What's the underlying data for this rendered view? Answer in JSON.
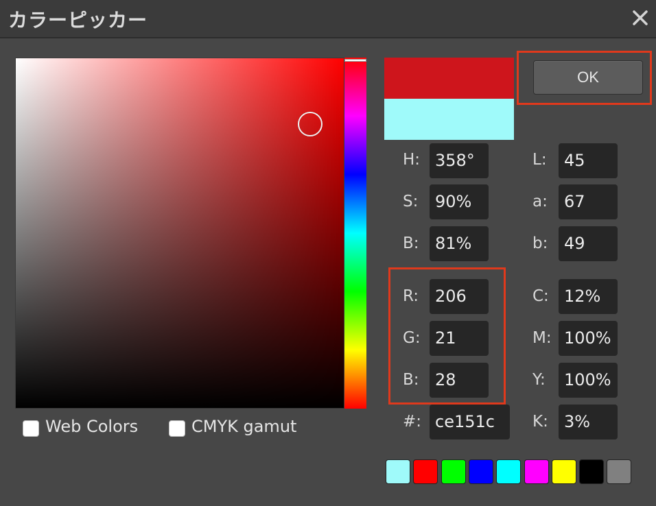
{
  "window": {
    "title": "カラーピッカー"
  },
  "ok_button": {
    "label": "OK"
  },
  "hsb": [
    {
      "label": "H:",
      "value": "358°"
    },
    {
      "label": "S:",
      "value": "90%"
    },
    {
      "label": "B:",
      "value": "81%"
    }
  ],
  "lab": [
    {
      "label": "L:",
      "value": "45"
    },
    {
      "label": "a:",
      "value": "67"
    },
    {
      "label": "b:",
      "value": "49"
    }
  ],
  "rgb": [
    {
      "label": "R:",
      "value": "206"
    },
    {
      "label": "G:",
      "value": "21"
    },
    {
      "label": "B:",
      "value": "28"
    }
  ],
  "cmyk": [
    {
      "label": "C:",
      "value": "12%"
    },
    {
      "label": "M:",
      "value": "100%"
    },
    {
      "label": "Y:",
      "value": "100%"
    },
    {
      "label": "K:",
      "value": "3%"
    }
  ],
  "hex": {
    "label": "#:",
    "value": "ce151c"
  },
  "options": {
    "web_colors": "Web Colors",
    "cmyk_gamut": "CMYK gamut"
  },
  "colors": {
    "new": "#ce151c",
    "original": "#9ffafa",
    "highlight": "#e0391c"
  },
  "swatches": [
    "#9ffafa",
    "#ff0000",
    "#00ff00",
    "#0000ff",
    "#00ffff",
    "#ff00ff",
    "#ffff00",
    "#000000",
    "#808080"
  ]
}
